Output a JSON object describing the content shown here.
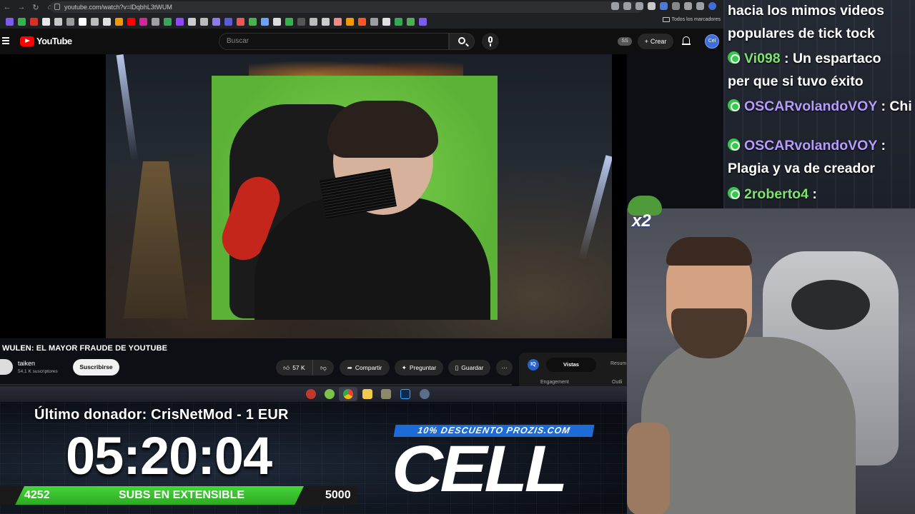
{
  "browser": {
    "url": "youtube.com/watch?v=lDqbhL3tWUM",
    "bookmarks_all_label": "Todos los marcadores"
  },
  "youtube": {
    "logo_text": "YouTube",
    "search_placeholder": "Buscar",
    "ss_badge": "SS",
    "create_label": "Crear",
    "avatar_text": "Cel"
  },
  "video": {
    "title": "WULEN: EL MAYOR FRAUDE DE YOUTUBE",
    "channel": "taiken",
    "subscribers": "54,1 K suscriptores",
    "subscribe_label": "Suscribirse",
    "likes": "57 K",
    "share_label": "Compartir",
    "ask_label": "Preguntar",
    "save_label": "Guardar"
  },
  "side_panel": {
    "logo": "IQ",
    "tab_active": "Vistas",
    "tab_other": "Resum",
    "engagement": "Engagement",
    "outline": "Outli"
  },
  "overlay": {
    "donor": "Último donador: CrisNetMod - 1 EUR",
    "timer": "05:20:04",
    "subs_current": "4252",
    "subs_label": "SUBS EN EXTENSIBLE",
    "subs_goal": "5000",
    "subs_progress": 0.85,
    "promo": "10% DESCUENTO PROZIS.COM",
    "cell_logo": "CELL"
  },
  "chat": {
    "messages": [
      {
        "user": "",
        "text": "hacia los mimos videos"
      },
      {
        "user": "",
        "text": "populares de tick tock"
      },
      {
        "user": "Vi098",
        "text": ": Un espartaco"
      },
      {
        "user": "",
        "text": "per que si tuvo éxito"
      },
      {
        "user": "OSCARvolandoVOY",
        "text": ": Chi"
      },
      {
        "user": "OSCARvolandoVOY",
        "text": ":"
      },
      {
        "user": "",
        "text": "Plagia y va de creador"
      },
      {
        "user": "2roberto4",
        "text": ":"
      }
    ],
    "emote_multiplier": "x2"
  },
  "colors": {
    "yt_red": "#ff0000",
    "sub_bar_green": "#3cc430",
    "promo_blue": "#1c6bd6",
    "chat_user_green": "#7ee36e",
    "chat_user_purple": "#b69cff"
  }
}
